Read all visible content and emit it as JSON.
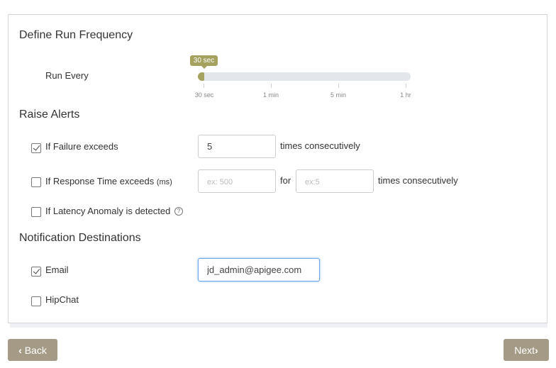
{
  "sections": {
    "frequency_title": "Define Run Frequency",
    "alerts_title": "Raise Alerts",
    "notifications_title": "Notification Destinations"
  },
  "run_frequency": {
    "label": "Run Every",
    "current_value": "30 sec",
    "ticks": [
      "30 sec",
      "1 min",
      "5 min",
      "1 hr"
    ]
  },
  "alerts": {
    "failure": {
      "label": "If Failure exceeds",
      "checked": true,
      "value": "5",
      "suffix": "times consecutively"
    },
    "response_time": {
      "label": "If Response Time exceeds",
      "unit": "(ms)",
      "checked": false,
      "placeholder": "ex: 500",
      "for_label": "for",
      "count_placeholder": "ex:5",
      "suffix": "times consecutively"
    },
    "latency": {
      "label": "If Latency Anomaly is detected",
      "checked": false,
      "help_glyph": "?"
    }
  },
  "notifications": {
    "email": {
      "label": "Email",
      "checked": true,
      "value": "jd_admin@apigee.com"
    },
    "hipchat": {
      "label": "HipChat",
      "checked": false
    }
  },
  "buttons": {
    "back": "Back",
    "next": "Next"
  },
  "colors": {
    "accent": "#a5a15e",
    "button": "#a59a86",
    "focus": "#6aa6e6"
  }
}
